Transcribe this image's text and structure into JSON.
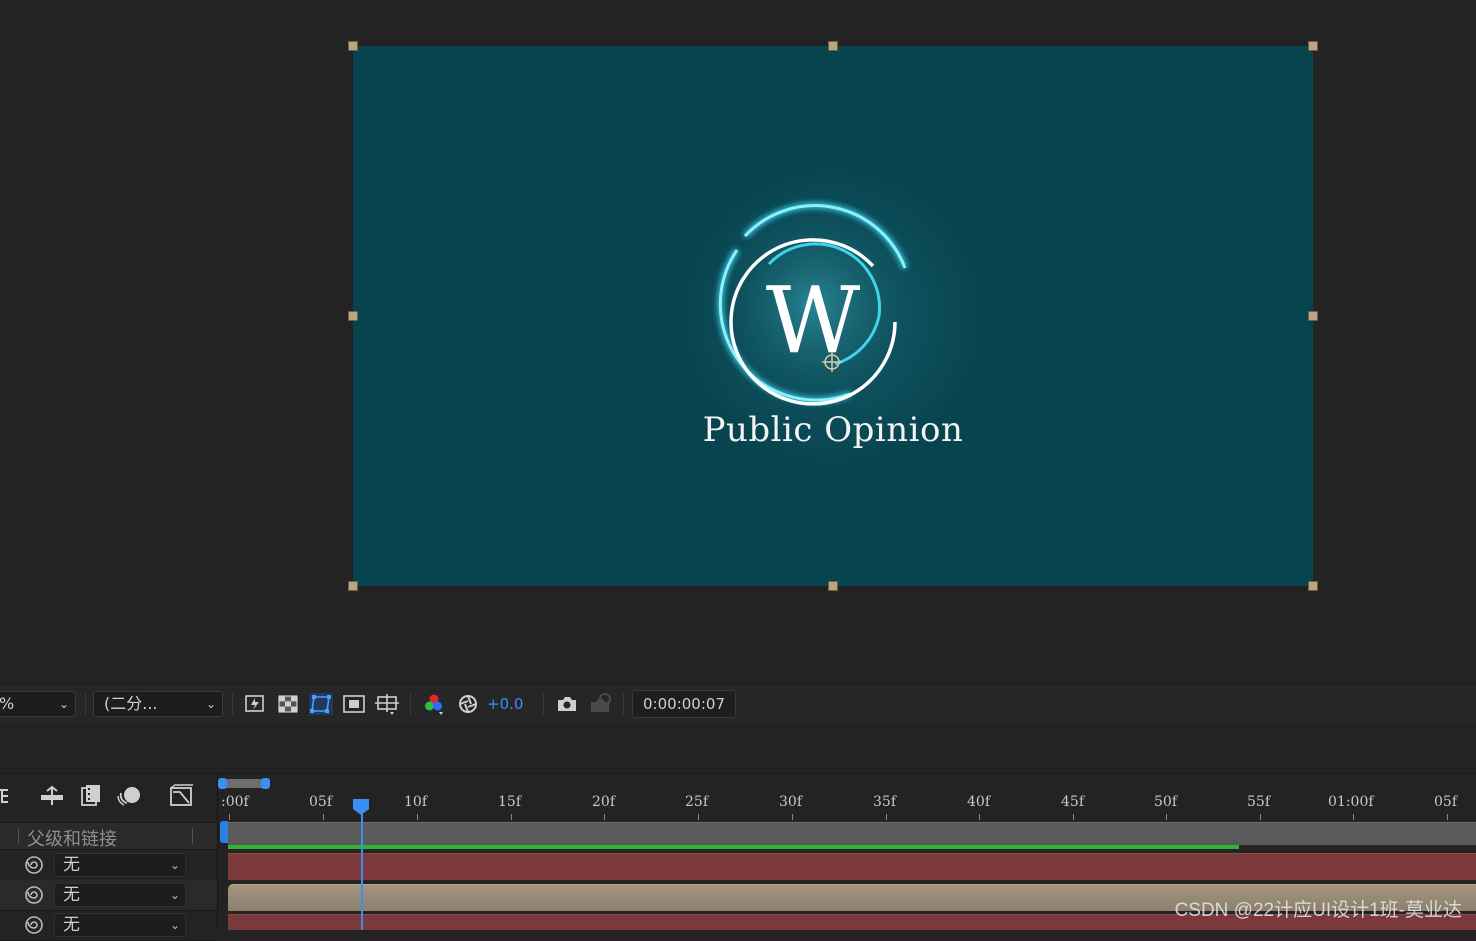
{
  "composition": {
    "background_color": "#07444f",
    "logo_letter": "W",
    "brand_text": "Public Opinion",
    "accent_color": "#3fd4ea"
  },
  "viewer_toolbar": {
    "zoom_value": "%",
    "resolution_value": "(二分...",
    "exposure_value": "+0.0",
    "timecode": "0:00:00:07",
    "icons": [
      "preview-region-icon",
      "transparency-grid-icon",
      "mask-path-icon",
      "safe-area-icon",
      "grid-guides-icon",
      "color-channel-icon",
      "reset-exposure-icon",
      "snapshot-icon",
      "show-snapshot-icon"
    ]
  },
  "timeline": {
    "header_icons": [
      "shy-icon",
      "draft-3d-icon",
      "frame-blending-icon",
      "motion-blur-icon",
      "graph-editor-icon"
    ],
    "column_header": "父级和链接",
    "layers": [
      {
        "parent": "无"
      },
      {
        "parent": "无"
      },
      {
        "parent": "无"
      }
    ],
    "ruler_labels": [
      ":00f",
      "05f",
      "10f",
      "15f",
      "20f",
      "25f",
      "30f",
      "35f",
      "40f",
      "45f",
      "50f",
      "55f",
      "01:00f",
      "05f"
    ],
    "current_frame": "07",
    "render_progress": 0.81
  },
  "watermark": "CSDN @22计应UI设计1班-莫业达"
}
